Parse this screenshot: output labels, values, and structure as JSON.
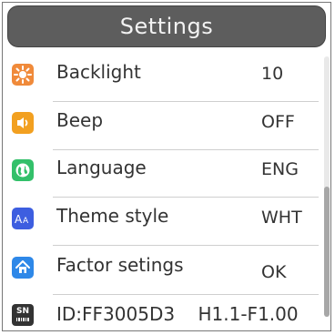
{
  "header": {
    "title": "Settings"
  },
  "menu": [
    {
      "label": "Backlight",
      "value": "10",
      "icon": "sun-icon",
      "color": "#f08a3a"
    },
    {
      "label": "Beep",
      "value": "OFF",
      "icon": "speaker-icon",
      "color": "#f2a020"
    },
    {
      "label": "Language",
      "value": "ENG",
      "icon": "globe-icon",
      "color": "#33c06a"
    },
    {
      "label": "Theme style",
      "value": "WHT",
      "icon": "font-aa-icon",
      "color": "#3d5ee0"
    },
    {
      "label": "Factor setings",
      "value": "OK",
      "icon": "home-icon",
      "color": "#2e88e8"
    }
  ],
  "device": {
    "icon_text": "SN",
    "info": "ID:FF3005D3    H1.1-F1.00",
    "icon": "serial-number-icon"
  },
  "scrollbar": {
    "position": "bottom"
  }
}
